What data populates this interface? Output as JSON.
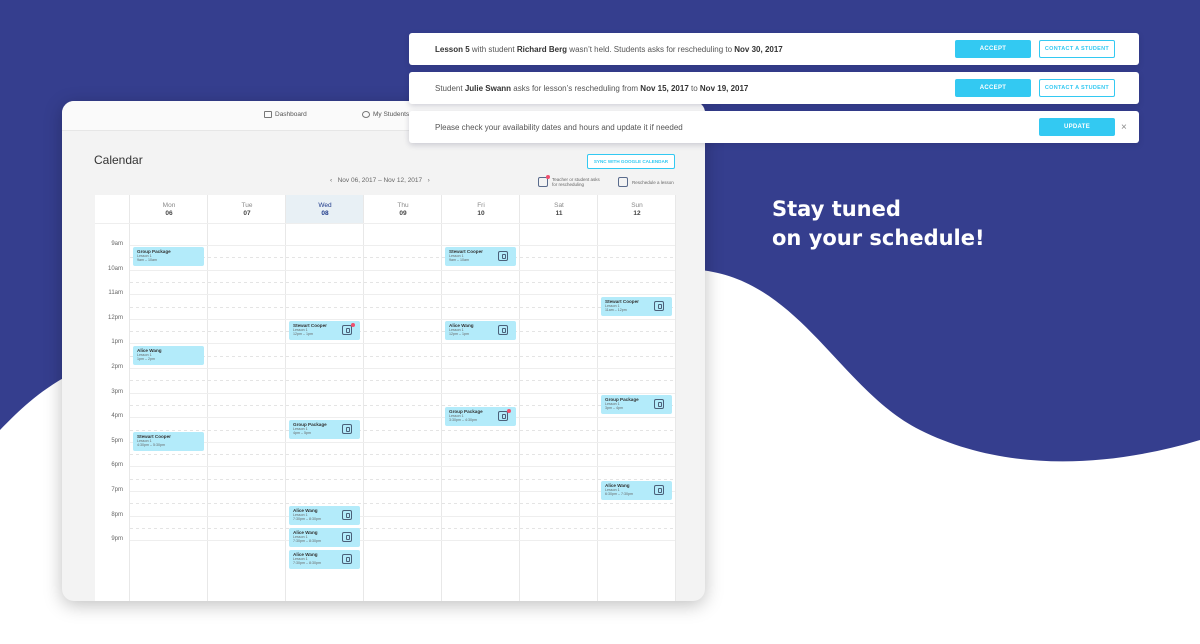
{
  "colors": {
    "brand_navy": "#353e8e",
    "accent_cyan": "#33c9f2",
    "event_fill": "#b3ebfa",
    "alert_dot": "#f0506e"
  },
  "tagline": {
    "line1": "Stay tuned",
    "line2": "on your schedule!"
  },
  "notifications": [
    {
      "parts": [
        "Lesson 5",
        " with student ",
        "Richard Berg",
        " wasn’t held. Students asks for rescheduling to ",
        "Nov 30, 2017"
      ],
      "accept": "ACCEPT",
      "contact": "CONTACT A STUDENT"
    },
    {
      "parts": [
        "Student ",
        "Julie Swann",
        " asks for lesson’s rescheduling from ",
        "Nov 15, 2017",
        " to ",
        "Nov 19, 2017"
      ],
      "accept": "ACCEPT",
      "contact": "CONTACT A STUDENT"
    },
    {
      "text": "Please check your availability dates and hours and update it if needed",
      "update": "UPDATE",
      "close": "×"
    }
  ],
  "nav": {
    "dashboard": "Dashboard",
    "students": "My Students"
  },
  "calendar": {
    "title": "Calendar",
    "sync": "SYNC WITH GOOGLE CALENDAR",
    "range_prev": "‹",
    "range": "Nov 06, 2017 – Nov 12, 2017",
    "range_next": "›",
    "legend_asks": "Teacher or student asks for rescheduling",
    "legend_reschedule": "Reschedule a lesson",
    "days": [
      {
        "name": "Mon",
        "num": "06"
      },
      {
        "name": "Tue",
        "num": "07"
      },
      {
        "name": "Wed",
        "num": "08",
        "today": true
      },
      {
        "name": "Thu",
        "num": "09"
      },
      {
        "name": "Fri",
        "num": "10"
      },
      {
        "name": "Sat",
        "num": "11"
      },
      {
        "name": "Sun",
        "num": "12"
      }
    ],
    "times": [
      "9am",
      "10am",
      "11am",
      "12pm",
      "1pm",
      "2pm",
      "3pm",
      "4pm",
      "5pm",
      "6pm",
      "7pm",
      "8pm",
      "9pm"
    ],
    "events": [
      {
        "day": 0,
        "start": 9.1,
        "name": "Group Package",
        "lesson": "Lesson 1",
        "time": "9am – 10am",
        "icon": false,
        "dot": false
      },
      {
        "day": 4,
        "start": 9.1,
        "name": "Stewart Cooper",
        "lesson": "Lesson 1",
        "time": "9am – 10am",
        "icon": true,
        "dot": false
      },
      {
        "day": 6,
        "start": 11.1,
        "name": "Stewart Cooper",
        "lesson": "Lesson 1",
        "time": "11am – 12pm",
        "icon": true,
        "dot": false
      },
      {
        "day": 2,
        "start": 12.1,
        "name": "Stewart Cooper",
        "lesson": "Lesson 1",
        "time": "12pm – 1pm",
        "icon": true,
        "dot": true
      },
      {
        "day": 4,
        "start": 12.1,
        "name": "Alice Wang",
        "lesson": "Lesson 1",
        "time": "12pm – 1pm",
        "icon": true,
        "dot": false
      },
      {
        "day": 0,
        "start": 13.1,
        "name": "Alice Wang",
        "lesson": "Lesson 1",
        "time": "1pm – 2pm",
        "icon": false,
        "dot": false
      },
      {
        "day": 6,
        "start": 15.1,
        "name": "Group Package",
        "lesson": "Lesson 1",
        "time": "3pm – 4pm",
        "icon": true,
        "dot": false
      },
      {
        "day": 4,
        "start": 15.6,
        "name": "Group Package",
        "lesson": "Lesson 1",
        "time": "3:30pm – 4:30pm",
        "icon": true,
        "dot": true
      },
      {
        "day": 2,
        "start": 16.1,
        "name": "Group Package",
        "lesson": "Lesson 1",
        "time": "4pm – 5pm",
        "icon": true,
        "dot": false
      },
      {
        "day": 0,
        "start": 16.6,
        "name": "Stewart Cooper",
        "lesson": "Lesson 1",
        "time": "4:30pm – 5:30pm",
        "icon": false,
        "dot": false
      },
      {
        "day": 6,
        "start": 18.6,
        "name": "Alice Wang",
        "lesson": "Lesson 1",
        "time": "6:30pm – 7:30pm",
        "icon": true,
        "dot": false
      },
      {
        "day": 2,
        "start": 19.6,
        "name": "Alice Wang",
        "lesson": "Lesson 1",
        "time": "7:30pm – 8:30pm",
        "icon": true,
        "dot": false
      },
      {
        "day": 2,
        "start": 20.5,
        "name": "Alice Wang",
        "lesson": "Lesson 1",
        "time": "7:30pm – 8:30pm",
        "icon": true,
        "dot": false
      },
      {
        "day": 2,
        "start": 21.4,
        "name": "Alice Wang",
        "lesson": "Lesson 1",
        "time": "7:30pm – 8:30pm",
        "icon": true,
        "dot": false
      }
    ]
  }
}
